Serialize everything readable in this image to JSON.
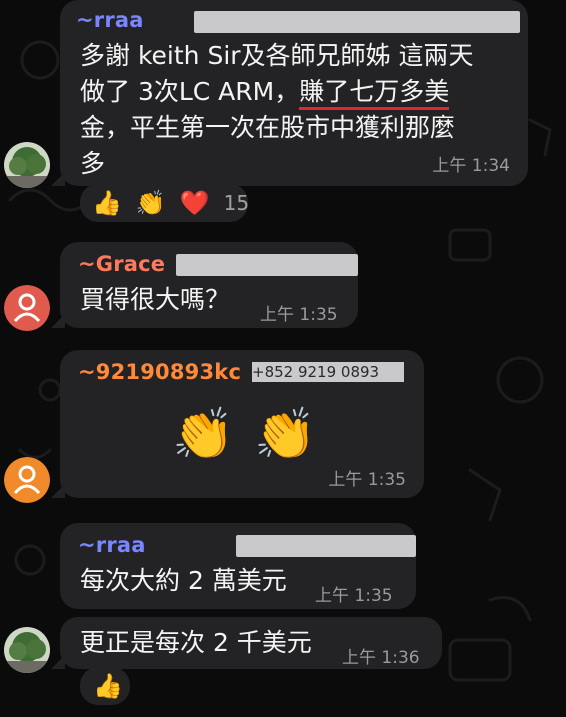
{
  "messages": [
    {
      "sender": "~rraa",
      "sender_color": "#7a86ff",
      "text_lines": [
        "多謝 keith Sir及各師兄師姊 這兩天",
        "做了 3次LC ARM，",
        "金，平生第一次在股市中獲利那麼",
        "多"
      ],
      "highlight": "賺了七万多美",
      "time": "上午 1:34",
      "reactions": {
        "items": [
          "👍",
          "👏",
          "❤️"
        ],
        "count": "15"
      }
    },
    {
      "sender": "~Grace",
      "sender_color": "#ff7a5c",
      "text": "買得很大嗎？",
      "time": "上午 1:35"
    },
    {
      "sender": "~92190893kc",
      "sender_color": "#ff8a3a",
      "sender_suffix": "+852 9219 0893",
      "emoji_text": "👏 👏",
      "time": "上午 1:35"
    },
    {
      "sender": "~rraa",
      "sender_color": "#7a86ff",
      "text": "每次大約 2 萬美元",
      "time": "上午 1:35"
    },
    {
      "text": "更正是每次 2 千美元",
      "time": "上午 1:36",
      "reactions": {
        "items": [
          "👍"
        ]
      }
    }
  ],
  "colors": {
    "bubble": "#232325",
    "background": "#0b0b0c",
    "underline": "#e8232b"
  }
}
